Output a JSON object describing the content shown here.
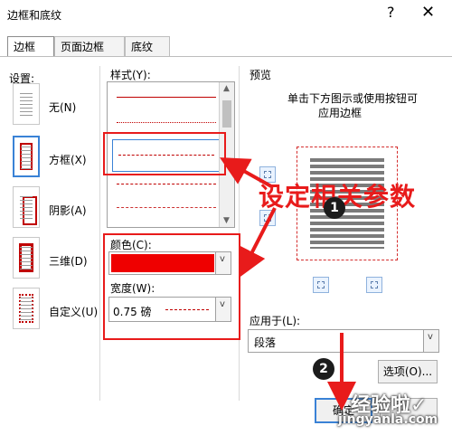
{
  "window": {
    "title": "边框和底纹",
    "help_icon": "?",
    "close_icon": "✕"
  },
  "tabs": [
    {
      "label": "边框(B)"
    },
    {
      "label": "页面边框(P)"
    },
    {
      "label": "底纹(S)"
    }
  ],
  "settings": {
    "header": "设置:",
    "items": [
      {
        "label": "无(N)"
      },
      {
        "label": "方框(X)"
      },
      {
        "label": "阴影(A)"
      },
      {
        "label": "三维(D)"
      },
      {
        "label": "自定义(U)"
      }
    ]
  },
  "style": {
    "header": "样式(Y):"
  },
  "color": {
    "label": "颜色(C):",
    "value_color": "#EF0000"
  },
  "width": {
    "label": "宽度(W):",
    "value": "0.75 磅"
  },
  "preview": {
    "header": "预览",
    "hint_line1": "单击下方图示或使用按钮可",
    "hint_line2": "应用边框"
  },
  "apply_to": {
    "label": "应用于(L):",
    "value": "段落"
  },
  "buttons": {
    "options": "选项(O)...",
    "ok": "确定"
  },
  "annotations": {
    "callout_text": "设定相关参数",
    "badge1": "1",
    "badge2": "2"
  },
  "watermark": {
    "site_name": "经验啦✓",
    "site_url": "jingyanla.com"
  }
}
